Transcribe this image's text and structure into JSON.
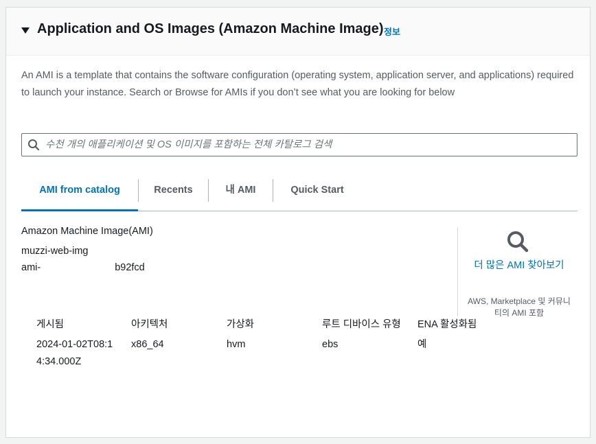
{
  "section": {
    "title": "Application and OS Images (Amazon Machine Image)",
    "info_link": "정보",
    "description": "An AMI is a template that contains the software configuration (operating system, application server, and applications) required to launch your instance. Search or Browse for AMIs if you don’t see what you are looking for below"
  },
  "search": {
    "placeholder": "수천 개의 애플리케이션 및 OS 이미지를 포함하는 전체 카탈로그 검색",
    "icon": "search-icon"
  },
  "tabs": [
    {
      "label": "AMI from catalog",
      "active": true
    },
    {
      "label": "Recents",
      "active": false
    },
    {
      "label": "내 AMI",
      "active": false
    },
    {
      "label": "Quick Start",
      "active": false
    }
  ],
  "ami": {
    "label": "Amazon Machine Image(AMI)",
    "name": "muzzi-web-img",
    "id_prefix": "ami-",
    "id_suffix": "b92fcd"
  },
  "browse_more": {
    "icon": "search-icon",
    "link": "더 많은 AMI 찾아보기",
    "subtext": "AWS, Marketplace 및 커뮤니티의 AMI 포함"
  },
  "details": [
    {
      "label": "게시됨",
      "value": "2024-01-02T08:14:34.000Z"
    },
    {
      "label": "아키텍처",
      "value": "x86_64"
    },
    {
      "label": "가상화",
      "value": "hvm"
    },
    {
      "label": "루트 디바이스 유형",
      "value": "ebs"
    },
    {
      "label": "ENA 활성화됨",
      "value": "예"
    }
  ],
  "colors": {
    "accent": "#0073bb",
    "text": "#16191f",
    "muted": "#545b64"
  }
}
